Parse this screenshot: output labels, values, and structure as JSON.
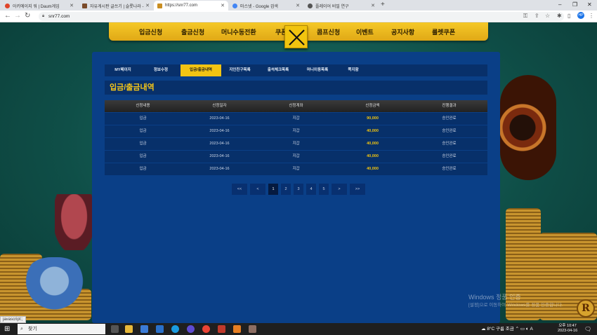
{
  "browser": {
    "tabs": [
      {
        "title": "아키에이지 워 | Daum게임",
        "color": "#e0452b"
      },
      {
        "title": "자유게시판 글쓰기 | 슬롯나라 -",
        "color": "#7a4b2a"
      },
      {
        "title": "https://snr77.com",
        "color": "#c98e22",
        "active": true
      },
      {
        "title": "마스넷 - Google 검색",
        "color": "#4285f4"
      },
      {
        "title": "플레이어 비밀 연구",
        "color": "#555555"
      }
    ],
    "new_tab": "+",
    "url": "snr77.com",
    "window_controls": [
      "–",
      "❐",
      "✕"
    ],
    "profile": "HP"
  },
  "top_menu": {
    "items": [
      "입금신청",
      "출금신청",
      "머니수동전환",
      "쿠폰",
      "콤프신청",
      "이벤트",
      "공지사항",
      "룰렛쿠폰"
    ]
  },
  "subnav": {
    "tabs": [
      {
        "label": "MY페이지"
      },
      {
        "label": "정보수정"
      },
      {
        "label": "입금/출금내역",
        "active": true
      },
      {
        "label": "지인친구목록"
      },
      {
        "label": "출석체크목록"
      },
      {
        "label": "머니이동목록"
      },
      {
        "label": "쪽지함"
      }
    ]
  },
  "page_title": "입금/출금내역",
  "table": {
    "headers": [
      "신청내용",
      "신청일자",
      "신청계좌",
      "신청금액",
      "진행결과"
    ],
    "rows": [
      [
        "입금",
        "2023-04-16",
        "지갑",
        "90,000",
        "승인완료"
      ],
      [
        "입금",
        "2023-04-16",
        "지갑",
        "40,000",
        "승인완료"
      ],
      [
        "입금",
        "2023-04-16",
        "지갑",
        "40,000",
        "승인완료"
      ],
      [
        "입금",
        "2023-04-16",
        "지갑",
        "40,000",
        "승인완료"
      ],
      [
        "입금",
        "2023-04-16",
        "지갑",
        "40,000",
        "승인완료"
      ]
    ]
  },
  "pagination": {
    "first": "<<",
    "prev": "<",
    "pages": [
      "1",
      "2",
      "3",
      "4",
      "5"
    ],
    "current": "1",
    "next": ">",
    "last": ">>"
  },
  "watermark": {
    "line1": "Windows 정품 인증",
    "line2": "[설정]으로 이동하여 Windows를 정품 인증합니다."
  },
  "logo_letter": "R",
  "status_text": "javascript:;",
  "taskbar": {
    "search_placeholder": "찾기",
    "weather": "8°C 구름 조금",
    "time": "오후 10:47",
    "date": "2023-04-16",
    "ime": "A"
  }
}
